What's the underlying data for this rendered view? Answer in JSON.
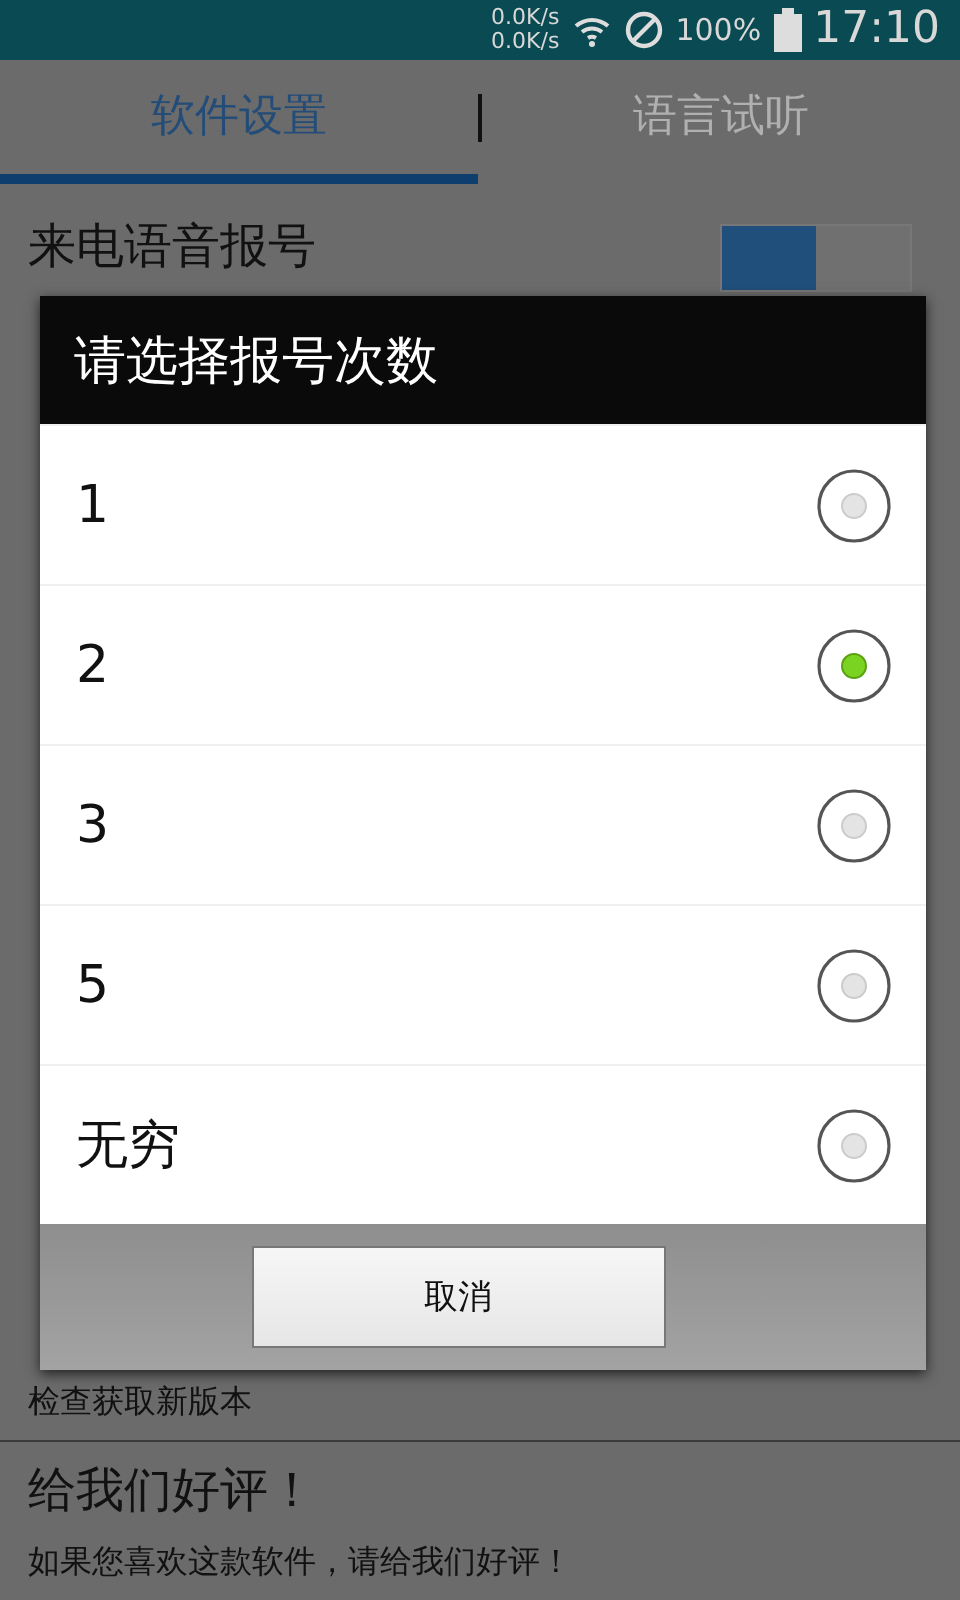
{
  "status_bar": {
    "upload_speed": "0.0K/s",
    "download_speed": "0.0K/s",
    "battery": "100%",
    "time": "17:10"
  },
  "tabs": [
    {
      "label": "软件设置",
      "selected": true
    },
    {
      "label": "语言试听",
      "selected": false
    }
  ],
  "settings_top": {
    "title": "来电语音报号",
    "switch": {
      "on": true
    }
  },
  "settings_bottom": [
    {
      "subtitle": "检查获取新版本"
    },
    {
      "title": "给我们好评！",
      "subtitle": "如果您喜欢这款软件，请给我们好评！"
    }
  ],
  "dialog": {
    "title": "请选择报号次数",
    "options": [
      {
        "label": "1",
        "selected": false
      },
      {
        "label": "2",
        "selected": true
      },
      {
        "label": "3",
        "selected": false
      },
      {
        "label": "5",
        "selected": false
      },
      {
        "label": "无穷",
        "selected": false
      }
    ],
    "cancel": "取消"
  }
}
